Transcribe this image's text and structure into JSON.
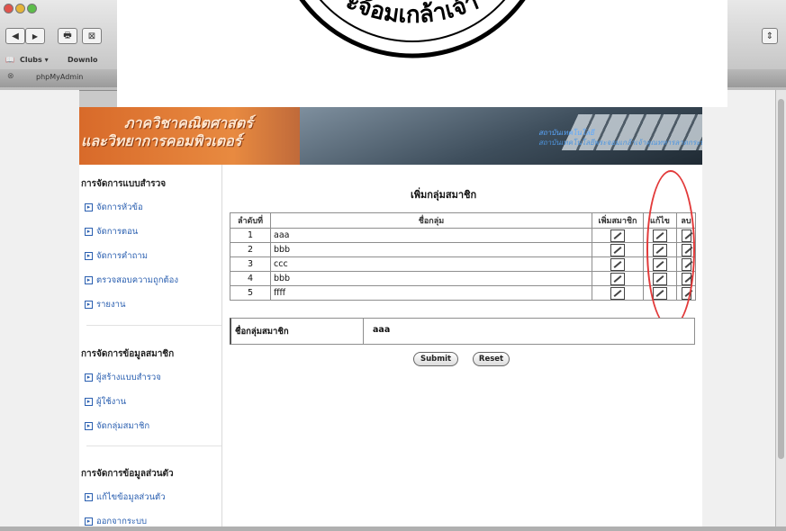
{
  "browser": {
    "bookmarks": [
      "Clubs ▾",
      "Downlo"
    ],
    "tab_title": "phpMyAdmin",
    "tab_close": "⊗",
    "back_glyph": "◀",
    "forward_glyph": "▶",
    "print_glyph": "🖶",
    "stop_glyph": "⊠",
    "right_glyph": "⇕"
  },
  "seal": {
    "text": "ะจ้อมเกล้าเจ้า"
  },
  "banner": {
    "line1": "ภาควิชาคณิตศาสตร์",
    "line2": "และวิทยาการคอมพิวเตอร์",
    "blue1": "สถาบันเทคโนโลยี",
    "blue2": "สถาบันเทคโนโลยีพระจอมเกล้าเจ้าคุณทหารลาดกระบัง"
  },
  "sidebar": {
    "sections": [
      {
        "title": "การจัดการแบบสำรวจ",
        "items": [
          "จัดการหัวข้อ",
          "จัดการตอน",
          "จัดการคำถาม",
          "ตรวจสอบความถูกต้อง",
          "รายงาน"
        ]
      },
      {
        "title": "การจัดการข้อมูลสมาชิก",
        "items": [
          "ผู้สร้างแบบสำรวจ",
          "ผู้ใช้งาน",
          "จัดกลุ่มสมาชิก"
        ]
      },
      {
        "title": "การจัดการข้อมูลส่วนตัว",
        "items": [
          "แก้ไขข้อมูลส่วนตัว",
          "ออกจากระบบ"
        ]
      }
    ]
  },
  "content": {
    "title": "เพิ่มกลุ่มสมาชิก",
    "columns": [
      "ลำดับที่",
      "ชื่อกลุ่ม",
      "เพิ่มสมาชิก",
      "แก้ไข",
      "ลบ"
    ],
    "rows": [
      {
        "num": "1",
        "name": "aaa"
      },
      {
        "num": "2",
        "name": "bbb"
      },
      {
        "num": "3",
        "name": "ccc"
      },
      {
        "num": "4",
        "name": "bbb"
      },
      {
        "num": "5",
        "name": "ffff"
      }
    ],
    "form_label": "ชื่อกลุ่มสมาชิก",
    "form_value": "aaa",
    "submit_label": "Submit",
    "reset_label": "Reset"
  },
  "colors": {
    "accent_orange": "#e07030",
    "link_blue": "#2a5fb0",
    "annotation_red": "#e23a3a"
  }
}
